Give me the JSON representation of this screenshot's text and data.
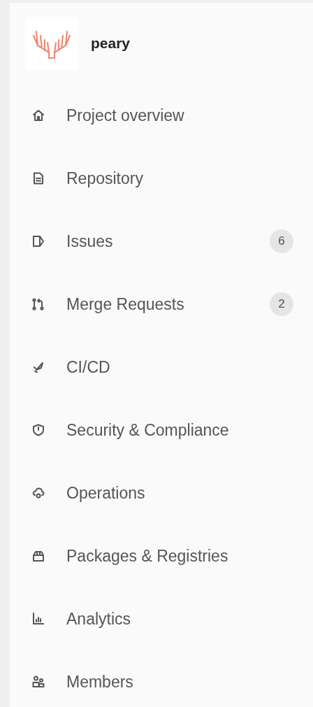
{
  "project": {
    "name": "peary"
  },
  "nav_items": [
    {
      "label": "Project overview"
    },
    {
      "label": "Repository"
    },
    {
      "label": "Issues",
      "count": "6"
    },
    {
      "label": "Merge Requests",
      "count": "2"
    },
    {
      "label": "CI/CD"
    },
    {
      "label": "Security & Compliance"
    },
    {
      "label": "Operations"
    },
    {
      "label": "Packages & Registries"
    },
    {
      "label": "Analytics"
    },
    {
      "label": "Members"
    }
  ]
}
